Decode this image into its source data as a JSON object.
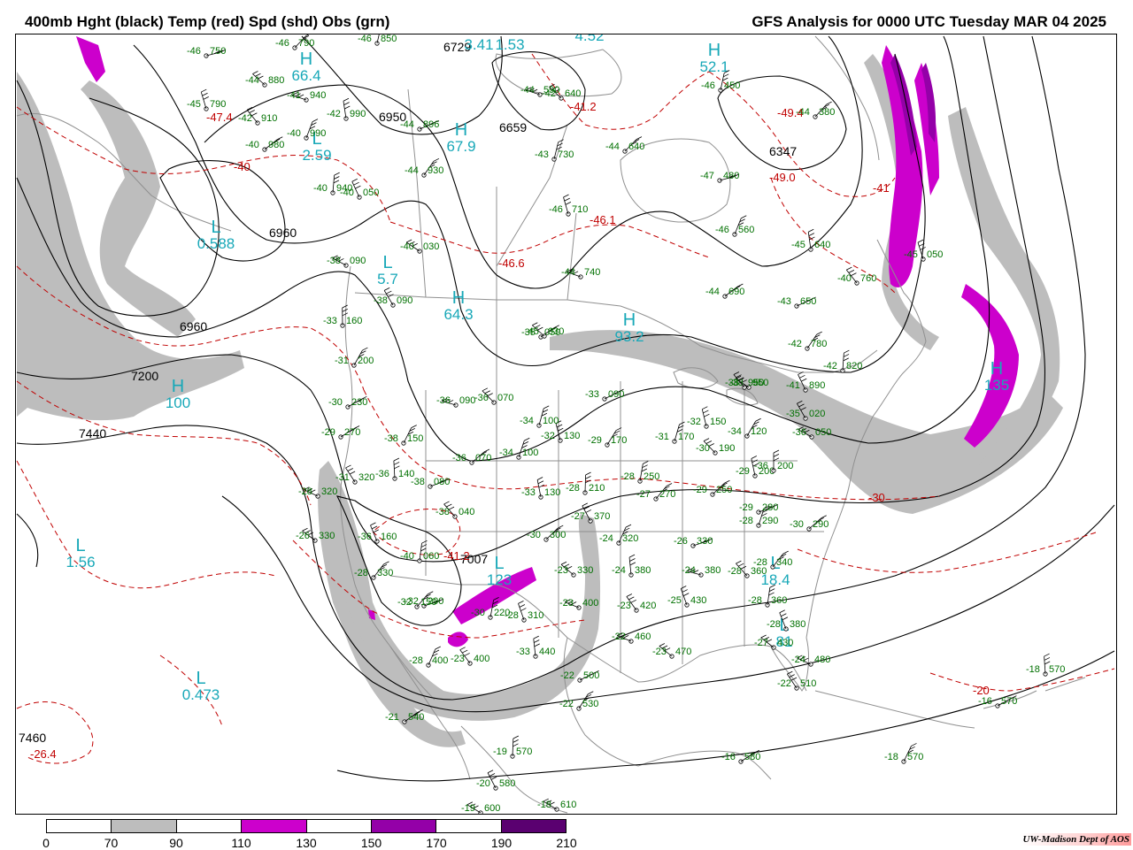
{
  "header": {
    "title_left": "400mb Hght (black) Temp (red) Spd (shd) Obs (grn)",
    "title_right": "GFS Analysis for 0000 UTC Tuesday  MAR 04 2025"
  },
  "colors": {
    "height_contour": "#000000",
    "temp_contour": "#c00000",
    "obs": "#007000",
    "system_label": "#18a8b8",
    "map_lines": "#808080"
  },
  "legend": {
    "ticks": [
      "0",
      "70",
      "90",
      "110",
      "130",
      "150",
      "170",
      "190",
      "210"
    ],
    "colors": [
      "#ffffff",
      "#bdbdbd",
      "#ffffff",
      "#cc00cc",
      "#ffffff",
      "#9400a8",
      "#ffffff",
      "#5a0070"
    ]
  },
  "credit": "UW-Madison  Dept of AOS",
  "height_labels": [
    "6729",
    "6659",
    "6950",
    "6960",
    "6960",
    "7200",
    "7440",
    "6347",
    "7460",
    "7007"
  ],
  "temp_labels": [
    "-40",
    "-47.4",
    "-41.2",
    "-46.1",
    "-46.6",
    "-49.4",
    "-49.0",
    "-41",
    "-30",
    "-20",
    "-26.4",
    "-41.2"
  ],
  "systems": [
    {
      "type": "L",
      "value": "3.41"
    },
    {
      "type": "L",
      "value": "1.53"
    },
    {
      "type": "H",
      "value": "66.4"
    },
    {
      "type": "H",
      "value": "67.9"
    },
    {
      "type": "H",
      "value": "4.52"
    },
    {
      "type": "L",
      "value": "2.59"
    },
    {
      "type": "L",
      "value": "0.588"
    },
    {
      "type": "L",
      "value": "5.7"
    },
    {
      "type": "H",
      "value": "64.3"
    },
    {
      "type": "H",
      "value": "100"
    },
    {
      "type": "H",
      "value": "93.2"
    },
    {
      "type": "L",
      "value": "1.56"
    },
    {
      "type": "L",
      "value": "0.473"
    },
    {
      "type": "L",
      "value": "123"
    },
    {
      "type": "L",
      "value": "18.4"
    },
    {
      "type": "H",
      "value": "135"
    },
    {
      "type": "H",
      "value": "52.1"
    },
    {
      "type": "L",
      "value": "81"
    }
  ],
  "observations": [
    {
      "t": "-46",
      "h": "750"
    },
    {
      "t": "-46",
      "h": "790"
    },
    {
      "t": "-46",
      "h": "850"
    },
    {
      "t": "-45",
      "h": "790"
    },
    {
      "t": "-44",
      "h": "880"
    },
    {
      "t": "-41",
      "h": "940"
    },
    {
      "t": "-42",
      "h": "910"
    },
    {
      "t": "-42",
      "h": "990"
    },
    {
      "t": "-40",
      "h": "990"
    },
    {
      "t": "-40",
      "h": "980"
    },
    {
      "t": "-44",
      "h": "896"
    },
    {
      "t": "-44",
      "h": "930"
    },
    {
      "t": "-40",
      "h": "940"
    },
    {
      "t": "-40",
      "h": "050"
    },
    {
      "t": "-40",
      "h": "030"
    },
    {
      "t": "-38",
      "h": "090"
    },
    {
      "t": "-38",
      "h": "090"
    },
    {
      "t": "-33",
      "h": "160"
    },
    {
      "t": "-31",
      "h": "200"
    },
    {
      "t": "-30",
      "h": "230"
    },
    {
      "t": "-29",
      "h": "270"
    },
    {
      "t": "-38",
      "h": "150"
    },
    {
      "t": "-36",
      "h": "140"
    },
    {
      "t": "-31",
      "h": "320"
    },
    {
      "t": "-28",
      "h": "320"
    },
    {
      "t": "-26",
      "h": "330"
    },
    {
      "t": "-36",
      "h": "160"
    },
    {
      "t": "-40",
      "h": "060"
    },
    {
      "t": "-28",
      "h": "330"
    },
    {
      "t": "-38",
      "h": "080"
    },
    {
      "t": "-36",
      "h": "070"
    },
    {
      "t": "-34",
      "h": "100"
    },
    {
      "t": "-33",
      "h": "130"
    },
    {
      "t": "-38",
      "h": "040"
    },
    {
      "t": "-36",
      "h": "090"
    },
    {
      "t": "-36",
      "h": "070"
    },
    {
      "t": "-32",
      "h": "130"
    },
    {
      "t": "-34",
      "h": "100"
    },
    {
      "t": "-30",
      "h": "300"
    },
    {
      "t": "-32",
      "h": "200"
    },
    {
      "t": "-32",
      "h": "150"
    },
    {
      "t": "-30",
      "h": "220"
    },
    {
      "t": "-28",
      "h": "310"
    },
    {
      "t": "-23",
      "h": "330"
    },
    {
      "t": "-23",
      "h": "400"
    },
    {
      "t": "-23",
      "h": "400"
    },
    {
      "t": "-33",
      "h": "440"
    },
    {
      "t": "-28",
      "h": "400"
    },
    {
      "t": "-21",
      "h": "540"
    },
    {
      "t": "-22",
      "h": "500"
    },
    {
      "t": "-22",
      "h": "530"
    },
    {
      "t": "-19",
      "h": "570"
    },
    {
      "t": "-20",
      "h": "580"
    },
    {
      "t": "-19",
      "h": "600"
    },
    {
      "t": "-18",
      "h": "610"
    },
    {
      "t": "-27",
      "h": "370"
    },
    {
      "t": "-28",
      "h": "210"
    },
    {
      "t": "-29",
      "h": "170"
    },
    {
      "t": "-33",
      "h": "090"
    },
    {
      "t": "-35",
      "h": "050"
    },
    {
      "t": "-24",
      "h": "320"
    },
    {
      "t": "-24",
      "h": "380"
    },
    {
      "t": "-23",
      "h": "420"
    },
    {
      "t": "-22",
      "h": "460"
    },
    {
      "t": "-23",
      "h": "470"
    },
    {
      "t": "-25",
      "h": "430"
    },
    {
      "t": "-28",
      "h": "250"
    },
    {
      "t": "-27",
      "h": "270"
    },
    {
      "t": "-26",
      "h": "330"
    },
    {
      "t": "-29",
      "h": "250"
    },
    {
      "t": "-31",
      "h": "170"
    },
    {
      "t": "-32",
      "h": "150"
    },
    {
      "t": "-30",
      "h": "190"
    },
    {
      "t": "-24",
      "h": "380"
    },
    {
      "t": "-28",
      "h": "360"
    },
    {
      "t": "-29",
      "h": "200"
    },
    {
      "t": "-28",
      "h": "290"
    },
    {
      "t": "-30",
      "h": "290"
    },
    {
      "t": "-29",
      "h": "280"
    },
    {
      "t": "-28",
      "h": "340"
    },
    {
      "t": "-28",
      "h": "360"
    },
    {
      "t": "-28",
      "h": "380"
    },
    {
      "t": "-27",
      "h": "430"
    },
    {
      "t": "-24",
      "h": "480"
    },
    {
      "t": "-22",
      "h": "510"
    },
    {
      "t": "-18",
      "h": "570"
    },
    {
      "t": "-18",
      "h": "570"
    },
    {
      "t": "-16",
      "h": "580"
    },
    {
      "t": "-16",
      "h": "570"
    },
    {
      "t": "-34",
      "h": "120"
    },
    {
      "t": "-36",
      "h": "200"
    },
    {
      "t": "-35",
      "h": "020"
    },
    {
      "t": "-36",
      "h": "050"
    },
    {
      "t": "-38",
      "h": "950"
    },
    {
      "t": "-41",
      "h": "890"
    },
    {
      "t": "-42",
      "h": "820"
    },
    {
      "t": "-42",
      "h": "780"
    },
    {
      "t": "-43",
      "h": "650"
    },
    {
      "t": "-44",
      "h": "690"
    },
    {
      "t": "-46",
      "h": "560"
    },
    {
      "t": "-45",
      "h": "640"
    },
    {
      "t": "-40",
      "h": "760"
    },
    {
      "t": "-44",
      "h": "740"
    },
    {
      "t": "-45",
      "h": "030"
    },
    {
      "t": "-45",
      "h": "050"
    },
    {
      "t": "-46",
      "h": "450"
    },
    {
      "t": "-44",
      "h": "380"
    },
    {
      "t": "-47",
      "h": "480"
    },
    {
      "t": "-44",
      "h": "640"
    },
    {
      "t": "-43",
      "h": "730"
    },
    {
      "t": "-46",
      "h": "710"
    },
    {
      "t": "-42",
      "h": "640"
    },
    {
      "t": "-44",
      "h": "590"
    },
    {
      "t": "-38",
      "h": "950"
    }
  ]
}
